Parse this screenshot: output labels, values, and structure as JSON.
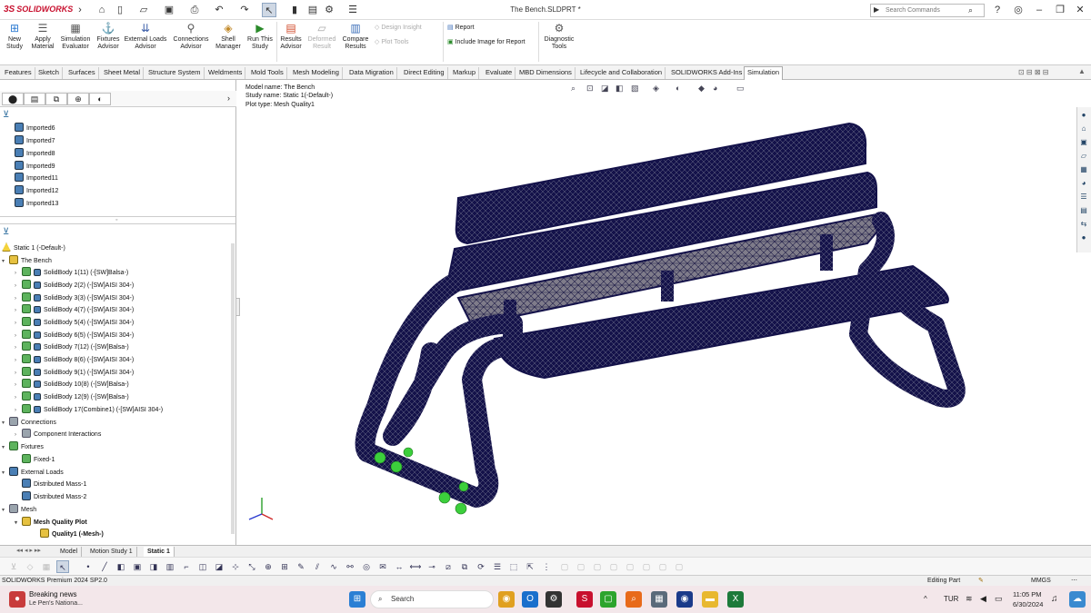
{
  "app": {
    "logo_text": "SOLIDWORKS",
    "logo_mark": "3S",
    "doc_title": "The Bench.SLDPRT *",
    "search_placeholder": "Search Commands"
  },
  "ribbon": {
    "big_buttons": [
      {
        "label": "New Study",
        "icon": "new-study-icon"
      },
      {
        "label": "Apply Material",
        "icon": "apply-material-icon"
      },
      {
        "label": "Simulation Evaluator",
        "icon": "simulation-evaluator-icon"
      },
      {
        "label": "Fixtures Advisor",
        "icon": "fixtures-advisor-icon"
      },
      {
        "label": "External Loads Advisor",
        "icon": "external-loads-icon"
      },
      {
        "label": "Connections Advisor",
        "icon": "connections-advisor-icon"
      },
      {
        "label": "Shell Manager",
        "icon": "shell-manager-icon"
      },
      {
        "label": "Run This Study",
        "icon": "run-study-icon"
      },
      {
        "label": "Results Advisor",
        "icon": "results-advisor-icon"
      },
      {
        "label": "Deformed Result",
        "icon": "deformed-result-icon"
      },
      {
        "label": "Compare Results",
        "icon": "compare-results-icon"
      },
      {
        "label": "Diagnostic Tools",
        "icon": "diagnostic-tools-icon"
      }
    ],
    "small": {
      "design_insight": "Design Insight",
      "plot_tools": "Plot Tools",
      "report": "Report",
      "include_image": "Include Image for Report"
    }
  },
  "tabs": [
    "Features",
    "Sketch",
    "Surfaces",
    "Sheet Metal",
    "Structure System",
    "Weldments",
    "Mold Tools",
    "Mesh Modeling",
    "Data Migration",
    "Direct Editing",
    "Markup",
    "Evaluate",
    "MBD Dimensions",
    "Lifecycle and Collaboration",
    "SOLIDWORKS Add-Ins",
    "Simulation"
  ],
  "active_tab": "Simulation",
  "feature_tree_top": [
    "Imported6",
    "Imported7",
    "Imported8",
    "Imported9",
    "Imported11",
    "Imported12",
    "Imported13"
  ],
  "sim_tree": {
    "study": "Static 1 (-Default-)",
    "part": "The Bench",
    "bodies": [
      "SolidBody 1(11) (-[SW]Balsa-)",
      "SolidBody 2(2) (-[SW]AISI 304-)",
      "SolidBody 3(3) (-[SW]AISI 304-)",
      "SolidBody 4(7) (-[SW]AISI 304-)",
      "SolidBody 5(4) (-[SW]AISI 304-)",
      "SolidBody 6(5) (-[SW]AISI 304-)",
      "SolidBody 7(12) (-[SW]Balsa-)",
      "SolidBody 8(6) (-[SW]AISI 304-)",
      "SolidBody 9(1) (-[SW]AISI 304-)",
      "SolidBody 10(8) (-[SW]Balsa-)",
      "SolidBody 12(9) (-[SW]Balsa-)",
      "SolidBody 17(Combine1) (-[SW]AISI 304-)"
    ],
    "connections": "Connections",
    "component_interactions": "Component Interactions",
    "fixtures": "Fixtures",
    "fixed": "Fixed-1",
    "external_loads": "External Loads",
    "loads": [
      "Distributed Mass-1",
      "Distributed Mass-2"
    ],
    "mesh": "Mesh",
    "mesh_plot": "Mesh Quality Plot",
    "quality": "Quality1 (-Mesh-)"
  },
  "viewport": {
    "model_name": "Model name: The Bench",
    "study_name": "Study name: Static 1(-Default-)",
    "plot_type": "Plot type: Mesh Quality1"
  },
  "bottom_tabs": [
    "Model",
    "Motion Study 1",
    "Static 1"
  ],
  "active_bottom_tab": "Static 1",
  "status": {
    "version": "SOLIDWORKS Premium 2024 SP2.0",
    "mode": "Editing Part",
    "units": "MMGS"
  },
  "taskbar": {
    "news_title": "Breaking news",
    "news_sub": "Le Pen's Nationa...",
    "search": "Search",
    "lang": "TUR",
    "time": "11:05 PM",
    "date": "6/30/2024"
  },
  "colors": {
    "accent": "#c8102e",
    "mesh": "#14124a",
    "fixture": "#3ccf3c"
  }
}
